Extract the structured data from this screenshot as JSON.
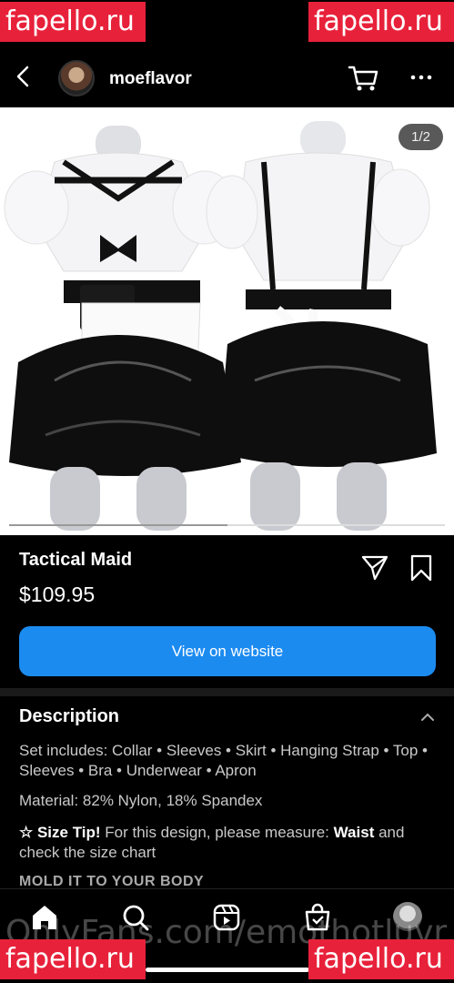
{
  "status": {
    "time": "",
    "icons": "• • •"
  },
  "watermarks": {
    "text": "fapello.ru",
    "bottom_text": "OnlyFans.com/emothotluvr"
  },
  "header": {
    "username": "moeflavor"
  },
  "gallery": {
    "counter": "1/2",
    "progress": 0.5
  },
  "product": {
    "title": "Tactical Maid",
    "price": "$109.95"
  },
  "cta": {
    "label": "View on website"
  },
  "description": {
    "heading": "Description",
    "items": "Set includes: Collar • Sleeves • Skirt • Hanging Strap • Top • Sleeves • Bra • Underwear • Apron",
    "material": "Material: 82% Nylon, 18% Spandex",
    "size_tip_label": "☆ Size Tip!",
    "size_tip_text_1": " For this design, please measure: ",
    "size_tip_bold": "Waist",
    "size_tip_text_2": " and check the size chart",
    "mold": "MOLD IT TO YOUR BODY"
  },
  "nav": {
    "items": [
      "home-icon",
      "search-icon",
      "reels-icon",
      "shop-icon",
      "profile-avatar"
    ]
  },
  "colors": {
    "accent": "#1c8bf0",
    "watermark": "#e8213a",
    "background": "#000000"
  }
}
